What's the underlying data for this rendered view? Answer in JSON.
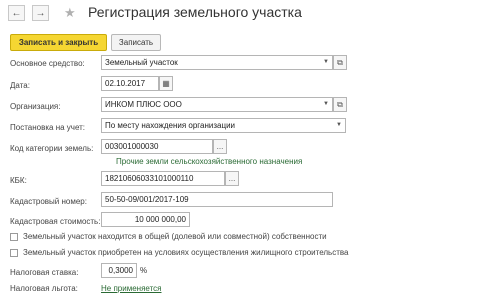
{
  "header": {
    "back_icon": "arrow-left-icon",
    "forward_icon": "arrow-right-icon",
    "favorite_icon": "star-icon",
    "title": "Регистрация земельного участка"
  },
  "toolbar": {
    "save_close_label": "Записать и закрыть",
    "save_label": "Записать"
  },
  "form": {
    "main_asset": {
      "label": "Основное средство:",
      "value": "Земельный участок"
    },
    "date": {
      "label": "Дата:",
      "value": "02.10.2017"
    },
    "organization": {
      "label": "Организация:",
      "value": "ИНКОМ ПЛЮС ООО"
    },
    "registration": {
      "label": "Постановка на учет:",
      "value": "По месту нахождения организации"
    },
    "land_category": {
      "label": "Код категории земель:",
      "value": "003001000030",
      "hint": "Прочие земли сельскохозяйственного назначения"
    },
    "kbk": {
      "label": "КБК:",
      "value": "18210606033101000110"
    },
    "cadastral_number": {
      "label": "Кадастровый номер:",
      "value": "50-50-09/001/2017-109"
    },
    "cadastral_value": {
      "label": "Кадастровая стоимость:",
      "value": "10 000 000,00"
    },
    "shared_ownership": {
      "label": "Земельный участок находится в общей (долевой или совместной) собственности",
      "checked": false
    },
    "housing_purchase": {
      "label": "Земельный участок приобретен на условиях осуществления жилищного строительства",
      "checked": false
    },
    "tax_rate": {
      "label": "Налоговая ставка:",
      "value": "0,3000",
      "unit": "%"
    },
    "tax_benefit": {
      "label": "Налоговая льгота:",
      "value": "Не применяется"
    }
  },
  "glyphs": {
    "back": "←",
    "forward": "→",
    "star": "★",
    "dropdown": "▼",
    "open": "⧉",
    "select": "...",
    "calendar": "▦"
  }
}
